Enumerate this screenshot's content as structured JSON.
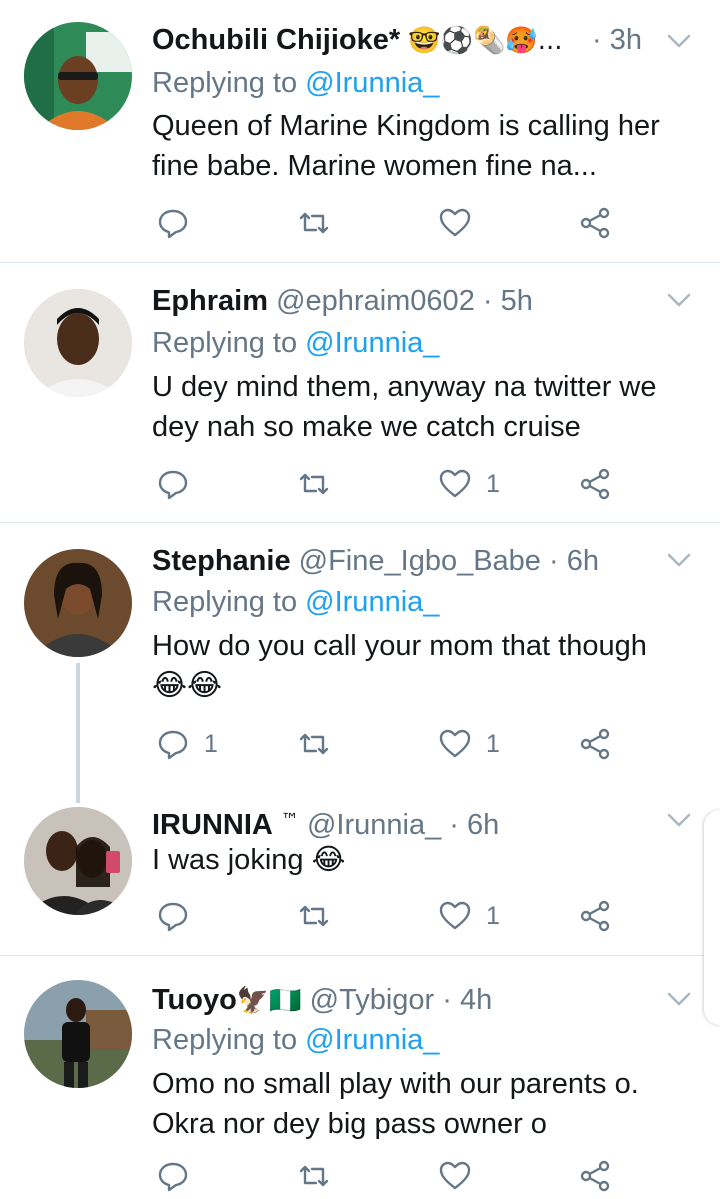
{
  "colors": {
    "accent": "#1da1f2",
    "muted": "#657786",
    "text": "#14171a",
    "divider": "#e1e8ed"
  },
  "tweets": [
    {
      "name": "Ochubili Chijioke*",
      "name_emoji": "🤓⚽🌯🥵...",
      "handle": "",
      "dot": "·",
      "time": "3h",
      "replying_prefix": "Replying to",
      "replying_to": "@Irunnia_",
      "text_lines": [
        "Queen of Marine Kingdom is calling her",
        "fine babe. Marine women fine na..."
      ],
      "reply_count": "",
      "like_count": "",
      "avatar_icon": "avatar-man-green-bg"
    },
    {
      "name": "Ephraim",
      "name_emoji": "",
      "handle": "@ephraim0602",
      "dot": "·",
      "time": "5h",
      "replying_prefix": "Replying to",
      "replying_to": "@Irunnia_",
      "text_lines": [
        "U dey mind them, anyway na twitter we",
        "dey nah so make we catch cruise"
      ],
      "reply_count": "",
      "like_count": "1",
      "avatar_icon": "avatar-young-man"
    },
    {
      "name": "Stephanie",
      "name_emoji": "",
      "handle": "@Fine_Igbo_Babe",
      "dot": "·",
      "time": "6h",
      "replying_prefix": "Replying to",
      "replying_to": "@Irunnia_",
      "text_lines": [
        "How do you call your mom that though",
        "😂😂"
      ],
      "reply_count": "1",
      "like_count": "1",
      "avatar_icon": "avatar-woman"
    },
    {
      "name": "IRUNNIA",
      "name_emoji": "™",
      "handle": "@Irunnia_",
      "dot": "·",
      "time": "6h",
      "replying_prefix": "",
      "replying_to": "",
      "text_lines": [
        "I was joking 😂"
      ],
      "reply_count": "",
      "like_count": "1",
      "avatar_icon": "avatar-couple"
    },
    {
      "name": "Tuoyo",
      "name_emoji": "🦅🇳🇬",
      "handle": "@Tybigor",
      "dot": "·",
      "time": "4h",
      "replying_prefix": "Replying to",
      "replying_to": "@Irunnia_",
      "text_lines": [
        "Omo no small play with our parents o.",
        "Okra nor dey big pass owner o"
      ],
      "reply_count": "",
      "like_count": "",
      "avatar_icon": "avatar-man-standing"
    }
  ]
}
